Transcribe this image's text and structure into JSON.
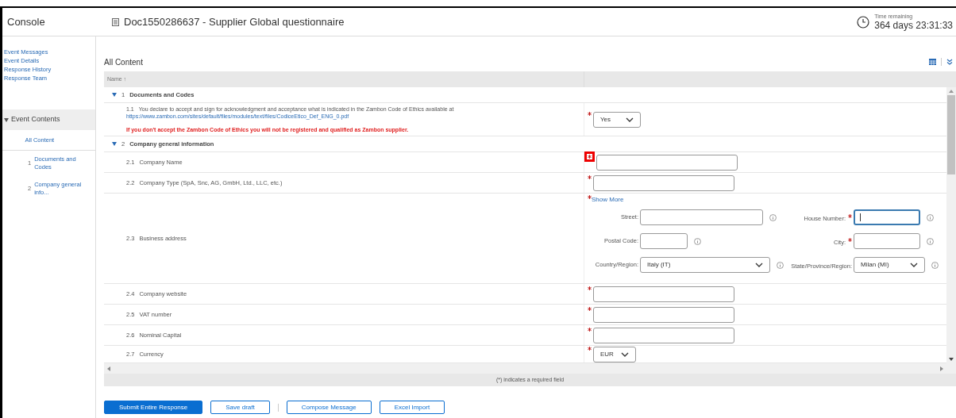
{
  "header": {
    "console": "Console",
    "title": "Doc1550286637 - Supplier Global questionnaire",
    "time_label": "Time remaining",
    "time_value": "364 days 23:31:33"
  },
  "sidebar": {
    "links": [
      "Event Messages",
      "Event Details",
      "Response History",
      "Response Team"
    ],
    "section": {
      "label": "Event Contents",
      "expanded": true
    },
    "items": [
      {
        "label": "All Content",
        "selected": true
      },
      {
        "number": "1",
        "label": "Documents and Codes",
        "selected": false
      },
      {
        "number": "2",
        "label": "Company general info...",
        "selected": false
      }
    ]
  },
  "content": {
    "title": "All Content",
    "column_header": "Name ↑",
    "sections": [
      {
        "number": "1",
        "title": "Documents and Codes",
        "expanded": true,
        "rows": [
          {
            "number": "1.1",
            "kind": "select",
            "label": "You declare to accept and sign for acknowledgment and acceptance what is indicated in the Zambon Code of Ethics available at",
            "link": "https://www.zambon.com/sites/default/files/modules/text/files/CodiceEtico_Def_ENG_0.pdf",
            "warning": "If you don't accept the Zambon Code of Ethics you will not be registered and qualified as Zambon supplier.",
            "required": true,
            "value": "Yes",
            "highlighted": false
          }
        ]
      },
      {
        "number": "2",
        "title": "Company general information",
        "expanded": true,
        "rows": [
          {
            "number": "2.1",
            "kind": "text",
            "label": "Company Name",
            "required": true,
            "highlighted": true
          },
          {
            "number": "2.2",
            "kind": "text",
            "label": "Company Type (SpA, Snc, AG, GmbH, Ltd., LLC, etc.)",
            "required": true,
            "highlighted": false
          },
          {
            "number": "2.3",
            "kind": "address",
            "label": "Business address",
            "required": true,
            "show_more": "Show More",
            "highlighted": false,
            "fields": [
              {
                "label": "Street:",
                "kind": "text",
                "required": false,
                "focused": false
              },
              {
                "label": "House Number:",
                "kind": "text",
                "required": true,
                "focused": true
              },
              {
                "label": "Postal Code:",
                "kind": "short",
                "required": false,
                "focused": false
              },
              {
                "label": "City:",
                "kind": "text",
                "required": true,
                "focused": false
              },
              {
                "label": "Country/Region:",
                "kind": "select",
                "value": "Italy (IT)",
                "required": false,
                "focused": false
              },
              {
                "label": "State/Province/Region:",
                "kind": "select",
                "value": "Milan (MI)",
                "required": false,
                "focused": false
              }
            ]
          },
          {
            "number": "2.4",
            "kind": "text",
            "label": "Company website",
            "required": true,
            "highlighted": false
          },
          {
            "number": "2.5",
            "kind": "text",
            "label": "VAT number",
            "required": true,
            "highlighted": false
          },
          {
            "number": "2.6",
            "kind": "text",
            "label": "Nominal Capital",
            "required": true,
            "highlighted": false
          },
          {
            "number": "2.7",
            "kind": "select",
            "label": "Currency",
            "required": true,
            "value": "EUR",
            "highlighted": false
          }
        ]
      }
    ],
    "footer_note": "(*) indicates a required field"
  },
  "buttons": [
    {
      "label": "Submit Entire Response",
      "kind": "primary"
    },
    {
      "label": "Save draft",
      "kind": "secondary"
    },
    {
      "label": "Compose Message",
      "kind": "secondary"
    },
    {
      "label": "Excel Import",
      "kind": "secondary"
    }
  ]
}
